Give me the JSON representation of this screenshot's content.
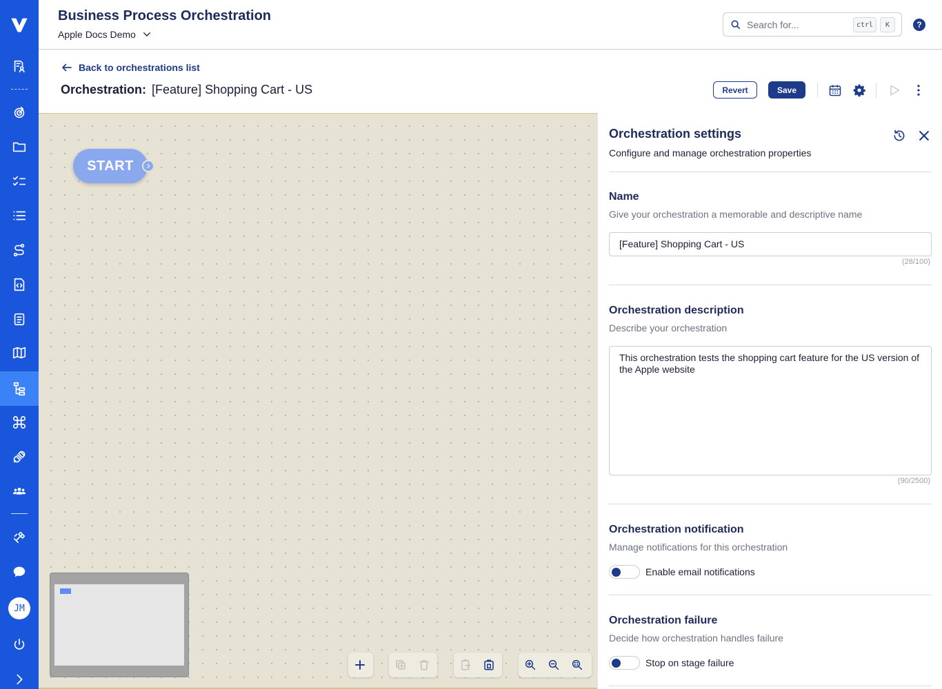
{
  "sidebar": {
    "logo": "V",
    "avatar_initials": "JM",
    "items": [
      {
        "icon": "document-user-icon"
      },
      {
        "icon": "target-icon"
      },
      {
        "icon": "folder-icon"
      },
      {
        "icon": "checklist-icon"
      },
      {
        "icon": "list-icon"
      },
      {
        "icon": "route-icon"
      },
      {
        "icon": "code-file-icon"
      },
      {
        "icon": "clipboard-list-icon"
      },
      {
        "icon": "map-icon"
      },
      {
        "icon": "orchestration-icon",
        "active": true
      },
      {
        "icon": "command-icon"
      },
      {
        "icon": "plug-icon"
      },
      {
        "icon": "users-icon"
      },
      {
        "icon": "satellite-icon"
      },
      {
        "icon": "chat-bubble-icon"
      },
      {
        "icon": "power-icon"
      },
      {
        "icon": "chevron-right-icon"
      }
    ]
  },
  "header": {
    "title": "Business Process Orchestration",
    "workspace": "Apple Docs Demo",
    "search_placeholder": "Search for...",
    "shortcut_keys": [
      "ctrl",
      "K"
    ],
    "help": "?"
  },
  "toolbar": {
    "back_label": "Back to orchestrations list",
    "orchestration_label": "Orchestration:",
    "orchestration_name": "[Feature] Shopping Cart - US",
    "revert_label": "Revert",
    "save_label": "Save"
  },
  "canvas": {
    "start_label": "START"
  },
  "settings": {
    "title": "Orchestration settings",
    "subtitle": "Configure and manage orchestration properties",
    "name": {
      "label": "Name",
      "description": "Give your orchestration a memorable and descriptive name",
      "value": "[Feature] Shopping Cart - US",
      "counter": "(28/100)"
    },
    "description": {
      "label": "Orchestration description",
      "description": "Describe your orchestration",
      "value": "This orchestration tests the shopping cart feature for the US version of the Apple website",
      "counter": "(90/2500)"
    },
    "notification": {
      "label": "Orchestration notification",
      "description": "Manage notifications for this orchestration",
      "toggle_label": "Enable email notifications",
      "enabled": false
    },
    "failure": {
      "label": "Orchestration failure",
      "description": "Decide how orchestration handles failure",
      "toggle_label": "Stop on stage failure",
      "enabled": false
    }
  },
  "colors": {
    "sidebar": "#1a56db",
    "sidebar_active": "#3b82f6",
    "primary": "#1e3a8a",
    "canvas_bg": "#e6e2d4",
    "start_node": "#8aa8ee"
  }
}
